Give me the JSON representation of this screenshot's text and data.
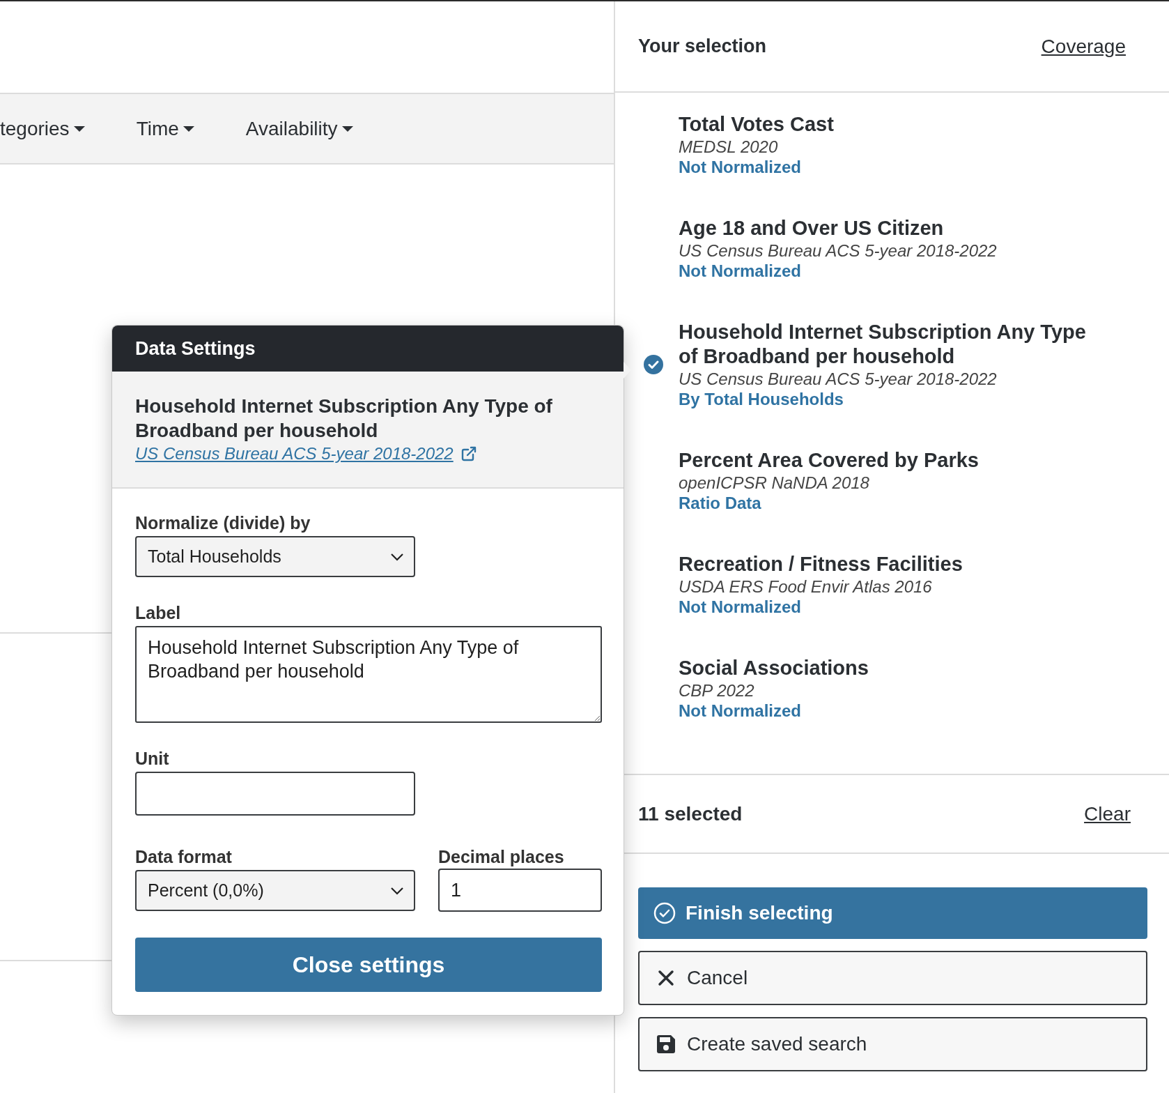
{
  "filter_bar": {
    "filters": [
      {
        "label": "tegories"
      },
      {
        "label": "Time"
      },
      {
        "label": "Availability"
      }
    ]
  },
  "selection_panel": {
    "title": "Your selection",
    "coverage_link": "Coverage",
    "items": [
      {
        "title": "Total Votes Cast",
        "source": "MEDSL 2020",
        "normalization": "Not Normalized",
        "selected": false
      },
      {
        "title": "Age 18 and Over US Citizen",
        "source": "US Census Bureau ACS 5-year 2018-2022",
        "normalization": "Not Normalized",
        "selected": false
      },
      {
        "title": "Household Internet Subscription Any Type of Broadband per household",
        "source": "US Census Bureau ACS 5-year 2018-2022",
        "normalization": "By Total Households",
        "selected": true
      },
      {
        "title": "Percent Area Covered by Parks",
        "source": "openICPSR NaNDA 2018",
        "normalization": "Ratio Data",
        "selected": false
      },
      {
        "title": "Recreation / Fitness Facilities",
        "source": "USDA ERS Food Envir Atlas 2016",
        "normalization": "Not Normalized",
        "selected": false
      },
      {
        "title": "Social Associations",
        "source": "CBP 2022",
        "normalization": "Not Normalized",
        "selected": false
      }
    ],
    "count": "11 selected",
    "clear_link": "Clear",
    "buttons": [
      {
        "label": "Finish selecting",
        "kind": "finish"
      },
      {
        "label": "Cancel",
        "kind": "cancel"
      },
      {
        "label": "Create saved search",
        "kind": "save"
      }
    ]
  },
  "data_settings": {
    "title": "Data Settings",
    "variable_title": "Household Internet Subscription Any Type of Broadband per household",
    "source_link": "US Census Bureau ACS 5-year 2018-2022",
    "normalize_by": {
      "label": "Normalize (divide) by",
      "value": "Total Households"
    },
    "label_field": {
      "label": "Label",
      "value": "Household Internet Subscription Any Type of Broadband per household"
    },
    "unit_field": {
      "label": "Unit"
    },
    "data_format": {
      "label": "Data format",
      "value": "Percent (0,0%)"
    },
    "decimal_places": {
      "label": "Decimal places",
      "value": "1"
    },
    "close_button": "Close settings"
  }
}
